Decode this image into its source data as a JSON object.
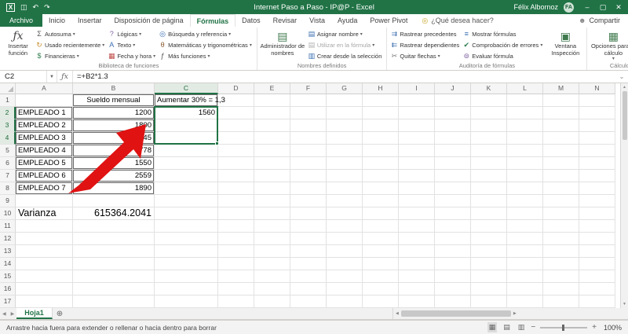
{
  "accent": "#217346",
  "title_bar": {
    "title": "Internet Paso a Paso - IP@P  -  Excel",
    "user": "Félix Albornoz",
    "avatar_initials": "FA"
  },
  "tabs": [
    {
      "label": "Archivo",
      "file": true
    },
    {
      "label": "Inicio"
    },
    {
      "label": "Insertar"
    },
    {
      "label": "Disposición de página"
    },
    {
      "label": "Fórmulas",
      "active": true
    },
    {
      "label": "Datos"
    },
    {
      "label": "Revisar"
    },
    {
      "label": "Vista"
    },
    {
      "label": "Ayuda"
    },
    {
      "label": "Power Pivot"
    }
  ],
  "search_label": "¿Qué desea hacer?",
  "share_label": "Compartir",
  "ribbon": {
    "library": {
      "name": "Biblioteca de funciones",
      "big": {
        "label": "Insertar función",
        "icon": "ƒx"
      },
      "buttons": [
        {
          "label": "Autosuma",
          "icon": "Σ",
          "color": "#555555",
          "dd": true
        },
        {
          "label": "Usado recientemente",
          "icon": "↻",
          "color": "#c78f2e",
          "dd": true
        },
        {
          "label": "Financieras",
          "icon": "$",
          "color": "#2e7d4f",
          "dd": true
        },
        {
          "label": "Lógicas",
          "icon": "?",
          "color": "#8064a2",
          "dd": true
        },
        {
          "label": "Texto",
          "icon": "A",
          "color": "#3a6fb0",
          "dd": true
        },
        {
          "label": "Fecha y hora",
          "icon": "▦",
          "color": "#c0504d",
          "dd": true
        },
        {
          "label": "Búsqueda y referencia",
          "icon": "◎",
          "color": "#3a6fb0",
          "dd": true
        },
        {
          "label": "Matemáticas y trigonométricas",
          "icon": "θ",
          "color": "#8a5a2e",
          "dd": true
        },
        {
          "label": "Más funciones",
          "icon": "ƒ",
          "color": "#555555",
          "dd": true
        }
      ]
    },
    "names": {
      "name": "Nombres definidos",
      "big": {
        "label": "Administrador de nombres",
        "icon": "▤"
      },
      "buttons": [
        {
          "label": "Asignar nombre",
          "icon": "▤",
          "color": "#3a6fb0",
          "dd": true
        },
        {
          "label": "Utilizar en la fórmula",
          "icon": "▤",
          "dd": true,
          "disabled": true
        },
        {
          "label": "Crear desde la selección",
          "icon": "▥",
          "color": "#3a6fb0"
        }
      ]
    },
    "audit": {
      "name": "Auditoría de fórmulas",
      "big": {
        "label": "Ventana Inspección",
        "icon": "▣"
      },
      "buttons": [
        {
          "label": "Rastrear precedentes",
          "icon": "⇉",
          "color": "#3a6fb0"
        },
        {
          "label": "Rastrear dependientes",
          "icon": "⇇",
          "color": "#3a6fb0"
        },
        {
          "label": "Quitar flechas",
          "icon": "✂",
          "color": "#777777",
          "dd": true
        },
        {
          "label": "Mostrar fórmulas",
          "icon": "≡",
          "color": "#3a6fb0"
        },
        {
          "label": "Comprobación de errores",
          "icon": "✔",
          "color": "#2e7d4f",
          "dd": true
        },
        {
          "label": "Evaluar fórmula",
          "icon": "⊚",
          "color": "#8064a2"
        }
      ]
    },
    "calc": {
      "name": "Cálculo",
      "big": {
        "label": "Opciones para el cálculo",
        "icon": "▦"
      },
      "buttons": [
        {
          "name": "calculate-now",
          "icon": "⊞",
          "color": "#777777"
        },
        {
          "name": "calculate-sheet",
          "icon": "⊟",
          "color": "#777777"
        }
      ]
    }
  },
  "formula_bar": {
    "cell_reference": "C2",
    "formula": "=+B2*1.3"
  },
  "grid": {
    "columns": [
      "A",
      "B",
      "C",
      "D",
      "E",
      "F",
      "G",
      "H",
      "I",
      "J",
      "K",
      "L",
      "M",
      "N"
    ],
    "rows": 17,
    "cells": {
      "B1": "Sueldo mensual",
      "C1": "Aumentar 30% = 1,3",
      "A2": "EMPLEADO 1",
      "B2": "1200",
      "C2": "1560",
      "A3": "EMPLEADO 2",
      "B3": "1800",
      "A4": "EMPLEADO 3",
      "B4": "2345",
      "A5": "EMPLEADO 4",
      "B5": "3778",
      "A6": "EMPLEADO 5",
      "B6": "1550",
      "A7": "EMPLEADO 6",
      "B7": "2559",
      "A8": "EMPLEADO 7",
      "B8": "1890",
      "A10": "Varianza",
      "B10": "615364.2041"
    },
    "bordered": [
      "B1",
      "C1",
      "A2",
      "B2",
      "A3",
      "B3",
      "A4",
      "B4",
      "A5",
      "B5",
      "A6",
      "B6",
      "A7",
      "B7",
      "A8",
      "B8"
    ],
    "big": [
      "A10",
      "B10"
    ],
    "center": [
      "B1"
    ],
    "selection": {
      "active_cell": "C2",
      "range": "C2:C4",
      "col": "C",
      "rows": [
        2,
        4
      ]
    }
  },
  "sheet_bar": {
    "active_tab": "Hoja1"
  },
  "status_bar": {
    "message": "Arrastre hacia fuera para extender o rellenar o hacia dentro para borrar",
    "zoom": "100%"
  }
}
